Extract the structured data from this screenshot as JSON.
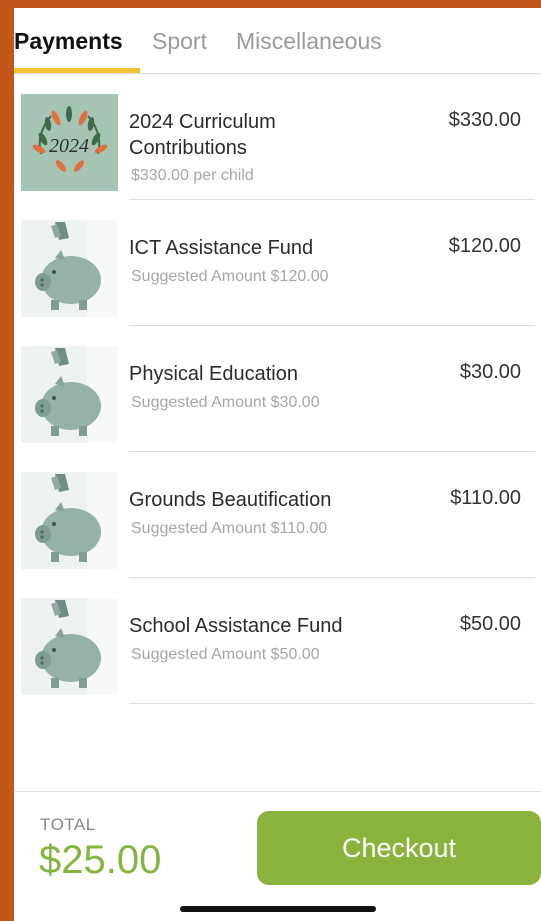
{
  "tabs": [
    {
      "label": "Payments",
      "active": true
    },
    {
      "label": "Sport",
      "active": false
    },
    {
      "label": "Miscellaneous",
      "active": false
    }
  ],
  "items": [
    {
      "title": "2024 Curriculum Contributions",
      "subtitle": "$330.00 per child",
      "price": "$330.00",
      "image": "2024-floral-wreath",
      "badge_text": "2024"
    },
    {
      "title": "ICT Assistance Fund",
      "subtitle": "Suggested Amount $120.00",
      "price": "$120.00",
      "image": "piggy-bank"
    },
    {
      "title": "Physical Education",
      "subtitle": "Suggested Amount $30.00",
      "price": "$30.00",
      "image": "piggy-bank"
    },
    {
      "title": "Grounds Beautification",
      "subtitle": "Suggested Amount $110.00",
      "price": "$110.00",
      "image": "piggy-bank"
    },
    {
      "title": "School Assistance Fund",
      "subtitle": "Suggested Amount $50.00",
      "price": "$50.00",
      "image": "piggy-bank"
    }
  ],
  "footer": {
    "total_label": "TOTAL",
    "total_value": "$25.00",
    "checkout_label": "Checkout"
  },
  "colors": {
    "frame": "#c2571b",
    "tab_underline": "#f0c233",
    "total_green": "#84b540",
    "checkout_green": "#8ab33d"
  }
}
